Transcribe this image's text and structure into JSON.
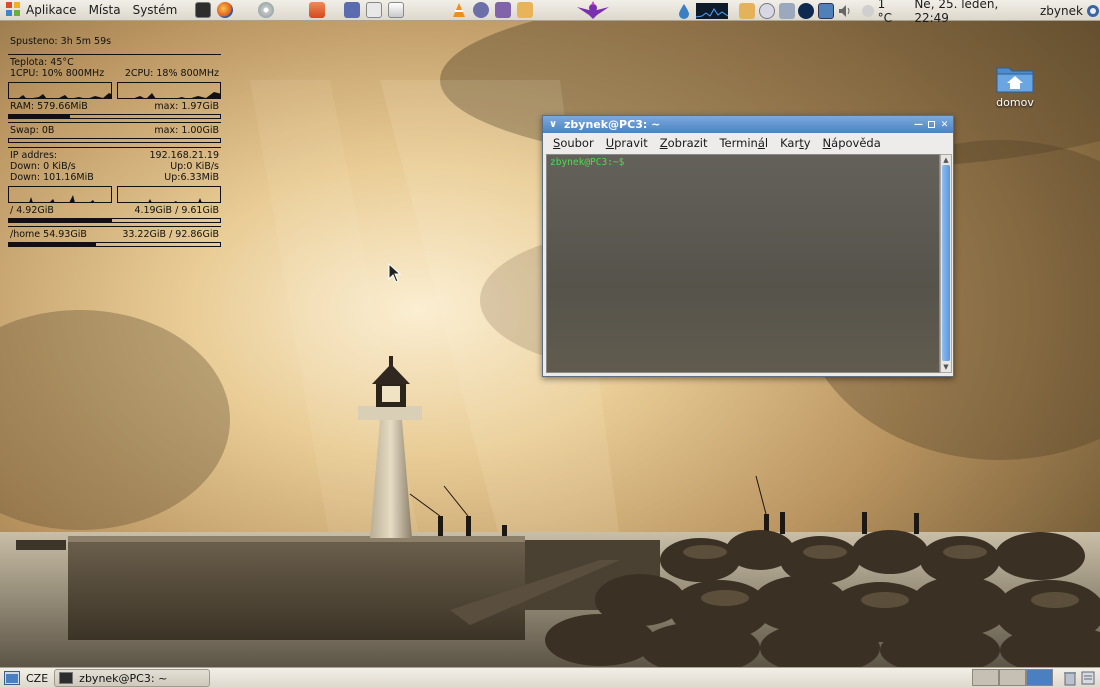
{
  "top_panel": {
    "menus": [
      {
        "label": "Aplikace",
        "icon": "gnome-foot-icon"
      },
      {
        "label": "Místa",
        "icon": ""
      },
      {
        "label": "Systém",
        "icon": ""
      }
    ],
    "launchers": [
      "terminal-icon",
      "firefox-icon",
      "disk-icon",
      "basket-icon",
      "emesene-icon",
      "mail-icon",
      "envelope-icon",
      "vlc-icon",
      "pidgin-icon",
      "text-editor-icon",
      "package-icon",
      "purple-bird-icon"
    ],
    "tray_icons": [
      "water-drop-icon",
      "system-monitor-icon",
      "folder-icon",
      "clock-sync-icon",
      "network-icon",
      "audio-app-icon",
      "display-icon",
      "volume-icon"
    ],
    "weather": "1 °C",
    "clock": "Ne, 25. leden, 22:49",
    "user": "zbynek"
  },
  "conky": {
    "uptime": "Spusteno: 3h 5m 59s",
    "temperature": "Teplota: 45°C",
    "cpu1": "1CPU: 10% 800MHz",
    "cpu2": "2CPU: 18% 800MHz",
    "ram": {
      "label": "RAM: 579.66MiB",
      "max": "max: 1.97GiB",
      "fraction": 0.29
    },
    "swap": {
      "label": "Swap: 0B",
      "max": "max: 1.00GiB",
      "fraction": 0.0
    },
    "ip_label": "IP addres:",
    "ip": "192.168.21.19",
    "down_rate": "Down: 0 KiB/s",
    "up_rate": "Up:0 KiB/s",
    "down_total": "Down: 101.16MiB",
    "up_total": "Up:6.33MiB",
    "root_fs": {
      "label": "/ 4.92GiB",
      "usage": "4.19GiB / 9.61GiB",
      "fraction": 0.49
    },
    "home_fs": {
      "label": "/home 54.93GiB",
      "usage": "33.22GiB / 92.86GiB",
      "fraction": 0.41
    }
  },
  "desktop": {
    "icons": [
      {
        "label": "domov",
        "icon": "home-folder-icon"
      }
    ]
  },
  "terminal": {
    "title": "zbynek@PC3: ~",
    "menus": [
      {
        "prefix": "",
        "mnemonic": "S",
        "rest": "oubor"
      },
      {
        "prefix": "",
        "mnemonic": "U",
        "rest": "pravit"
      },
      {
        "prefix": "",
        "mnemonic": "Z",
        "rest": "obrazit"
      },
      {
        "prefix": "Termin",
        "mnemonic": "á",
        "rest": "l"
      },
      {
        "prefix": "Kar",
        "mnemonic": "t",
        "rest": "y"
      },
      {
        "prefix": "",
        "mnemonic": "N",
        "rest": "ápověda"
      }
    ],
    "prompt": "zbynek@PC3:~$",
    "prompt_color": "#4ddb4d"
  },
  "bottom_panel": {
    "keyboard_layout": "CZE",
    "task": "zbynek@PC3: ~",
    "workspaces": 4,
    "active_workspace": 3
  },
  "colors": {
    "panel": "#e6e2d9",
    "titlebar": "#4d82c2",
    "prompt": "#4ddb4d"
  }
}
